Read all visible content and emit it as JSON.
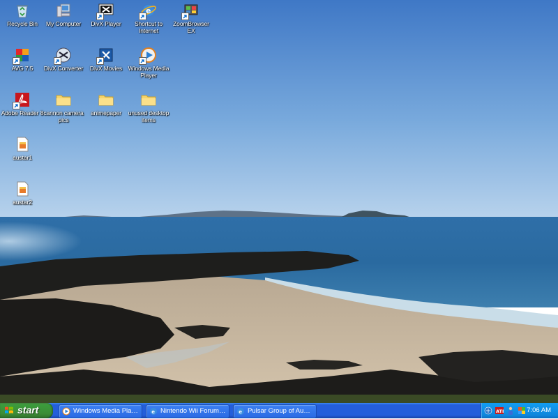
{
  "desktop": {
    "icons": [
      {
        "label": "Recycle Bin",
        "icon": "recycle-bin-icon"
      },
      {
        "label": "My Computer",
        "icon": "my-computer-icon"
      },
      {
        "label": "DivX Player",
        "icon": "divx-player-icon"
      },
      {
        "label": "Shortcut to Internet",
        "icon": "internet-explorer-icon"
      },
      {
        "label": "ZoomBrowser EX",
        "icon": "zoombrowser-icon"
      },
      {
        "label": "AVG 7.5",
        "icon": "avg-icon"
      },
      {
        "label": "DivX Converter",
        "icon": "divx-converter-icon"
      },
      {
        "label": "DivX Movies",
        "icon": "divx-movies-icon"
      },
      {
        "label": "Windows Media Player",
        "icon": "windows-media-player-icon"
      },
      {
        "label": "Adobe Reader 8",
        "icon": "adobe-reader-icon"
      },
      {
        "label": "cannon camera pics",
        "icon": "folder-icon"
      },
      {
        "label": "animepaper",
        "icon": "folder-icon"
      },
      {
        "label": "unused desktop items",
        "icon": "folder-icon"
      },
      {
        "label": "austar1",
        "icon": "image-file-icon"
      },
      {
        "label": "austar2",
        "icon": "image-file-icon"
      }
    ]
  },
  "taskbar": {
    "start_label": "start",
    "tasks": [
      {
        "label": "Windows Media Player",
        "icon": "windows-media-player-icon"
      },
      {
        "label": "Nintendo Wii Forum - ...",
        "icon": "internet-explorer-icon"
      },
      {
        "label": "Pulsar Group of Austr...",
        "icon": "internet-explorer-icon"
      }
    ],
    "tray": {
      "icons": [
        "network-icon",
        "ati-icon",
        "user-icon",
        "security-center-icon"
      ],
      "clock": "7:06 AM"
    }
  },
  "colors": {
    "taskbar_blue": "#245edb",
    "start_green": "#3c8c37",
    "tray_blue": "#0f86dc",
    "sky": "#5b8fd0"
  }
}
